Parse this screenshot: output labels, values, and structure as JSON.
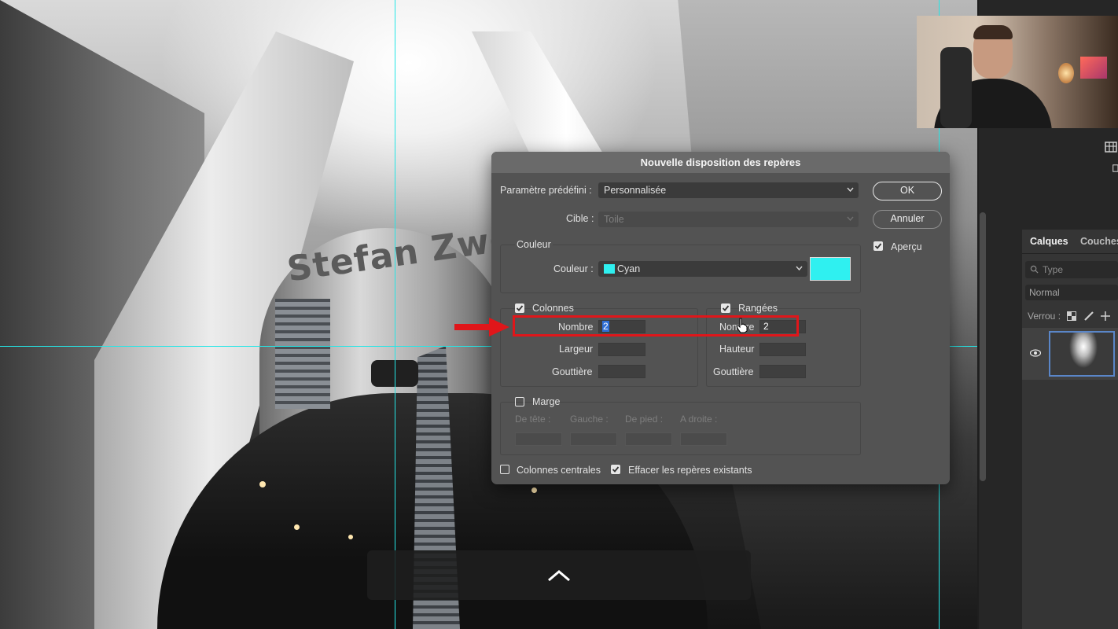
{
  "dialog": {
    "title": "Nouvelle disposition des repères",
    "preset_label": "Paramètre prédéfini :",
    "preset_value": "Personnalisée",
    "target_label": "Cible :",
    "target_value": "Toile",
    "color_section": {
      "title": "Couleur",
      "label": "Couleur :",
      "value": "Cyan",
      "swatch_color": "#2ff0f0"
    },
    "columns": {
      "title": "Colonnes",
      "checked": true,
      "number_label": "Nombre",
      "number_value": "2",
      "width_label": "Largeur",
      "width_value": "",
      "gutter_label": "Gouttière",
      "gutter_value": ""
    },
    "rows": {
      "title": "Rangées",
      "checked": true,
      "number_label": "Nombre",
      "number_value": "2",
      "height_label": "Hauteur",
      "height_value": "",
      "gutter_label": "Gouttière",
      "gutter_value": ""
    },
    "margin": {
      "title": "Marge",
      "checked": false,
      "top_label": "De tête :",
      "left_label": "Gauche :",
      "bottom_label": "De pied :",
      "right_label": "A droite :"
    },
    "center_columns_label": "Colonnes centrales",
    "center_columns_checked": false,
    "clear_existing_label": "Effacer les repères existants",
    "clear_existing_checked": true,
    "ok_label": "OK",
    "cancel_label": "Annuler",
    "preview_label": "Aperçu",
    "preview_checked": true
  },
  "layers_panel": {
    "tabs": [
      "Calques",
      "Couches"
    ],
    "filter_placeholder": "Type",
    "blend_mode": "Normal",
    "lock_label": "Verrou :"
  },
  "canvas": {
    "sign_text": "Stefan Zwe",
    "guide_color": "#25e6e6"
  },
  "colors": {
    "accent_blue": "#2f6fd6",
    "highlight_red": "#e0161a"
  }
}
